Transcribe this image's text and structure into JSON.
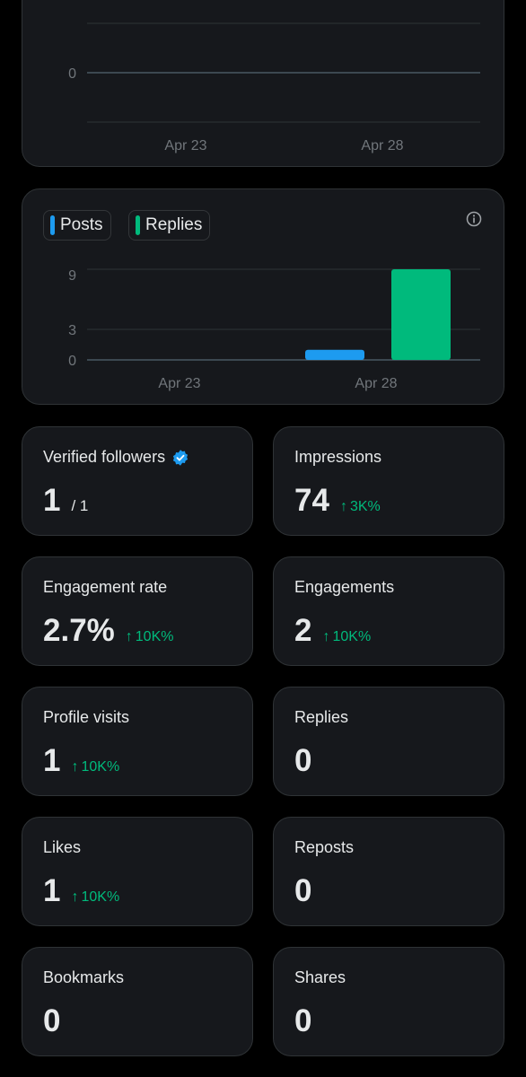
{
  "top_chart": {
    "y_ticks": [
      "0"
    ],
    "x_ticks": [
      "Apr 23",
      "Apr 28"
    ]
  },
  "bottom_chart": {
    "legend": [
      {
        "label": "Posts",
        "color": "#1d9bf0"
      },
      {
        "label": "Replies",
        "color": "#00ba7c"
      }
    ],
    "info_icon": "info-icon"
  },
  "chart_data": [
    {
      "type": "line",
      "x": [
        "Apr 23",
        "Apr 28"
      ],
      "y_tick_labels": [
        "0"
      ],
      "x_tick_labels": [
        "Apr 23",
        "Apr 28"
      ],
      "series": []
    },
    {
      "type": "bar",
      "categories": [
        "Apr 28"
      ],
      "x_tick_labels": [
        "Apr 23",
        "Apr 28"
      ],
      "y_tick_labels": [
        "9",
        "3",
        "0"
      ],
      "ylim": [
        0,
        9
      ],
      "series": [
        {
          "name": "Posts",
          "color": "#1d9bf0",
          "values": [
            1
          ]
        },
        {
          "name": "Replies",
          "color": "#00ba7c",
          "values": [
            9
          ]
        }
      ],
      "legend": "top-left",
      "grid": true
    }
  ],
  "stats": [
    {
      "id": "verified-followers",
      "label": "Verified followers",
      "value": "1",
      "suffix": "/ 1",
      "verified_icon": true
    },
    {
      "id": "impressions",
      "label": "Impressions",
      "value": "74",
      "change": "3K%"
    },
    {
      "id": "engagement-rate",
      "label": "Engagement rate",
      "value": "2.7%",
      "change": "10K%"
    },
    {
      "id": "engagements",
      "label": "Engagements",
      "value": "2",
      "change": "10K%"
    },
    {
      "id": "profile-visits",
      "label": "Profile visits",
      "value": "1",
      "change": "10K%"
    },
    {
      "id": "replies",
      "label": "Replies",
      "value": "0"
    },
    {
      "id": "likes",
      "label": "Likes",
      "value": "1",
      "change": "10K%"
    },
    {
      "id": "reposts",
      "label": "Reposts",
      "value": "0"
    },
    {
      "id": "bookmarks",
      "label": "Bookmarks",
      "value": "0"
    },
    {
      "id": "shares",
      "label": "Shares",
      "value": "0"
    }
  ],
  "colors": {
    "positive": "#00ba7c",
    "verified": "#1d9bf0"
  }
}
